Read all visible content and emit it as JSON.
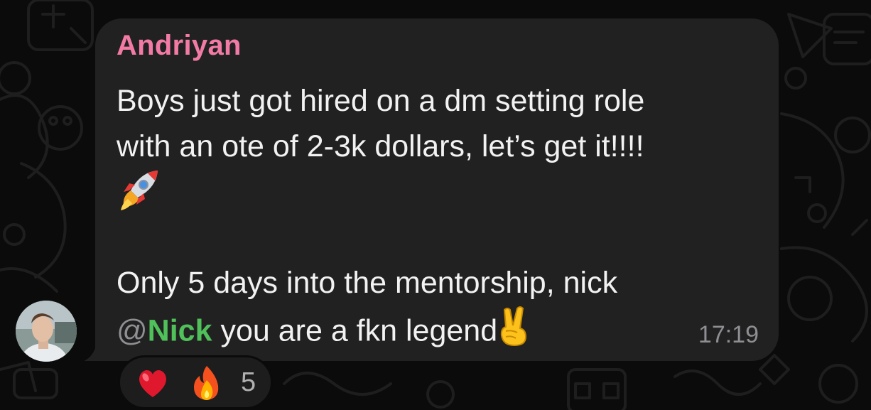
{
  "message": {
    "sender": "Andriyan",
    "line1": "Boys just got hired on a dm setting role",
    "line2": "with an ote of 2-3k dollars, let’s get it!!!!",
    "line4": "Only 5 days into the mentorship, nick",
    "mention_at": "@",
    "mention_name": "Nick",
    "line5_rest": " you are a fkn legend",
    "time": "17:19",
    "emoji_rocket": "rocket-icon",
    "emoji_victory": "victory-hand-icon"
  },
  "reactions": {
    "heart": "red-heart-icon",
    "fire": "fire-icon",
    "count": "5"
  },
  "colors": {
    "sender": "#f27ba6",
    "mention": "#4fc05a",
    "bubble": "#212121",
    "background": "#0b0b0b"
  }
}
